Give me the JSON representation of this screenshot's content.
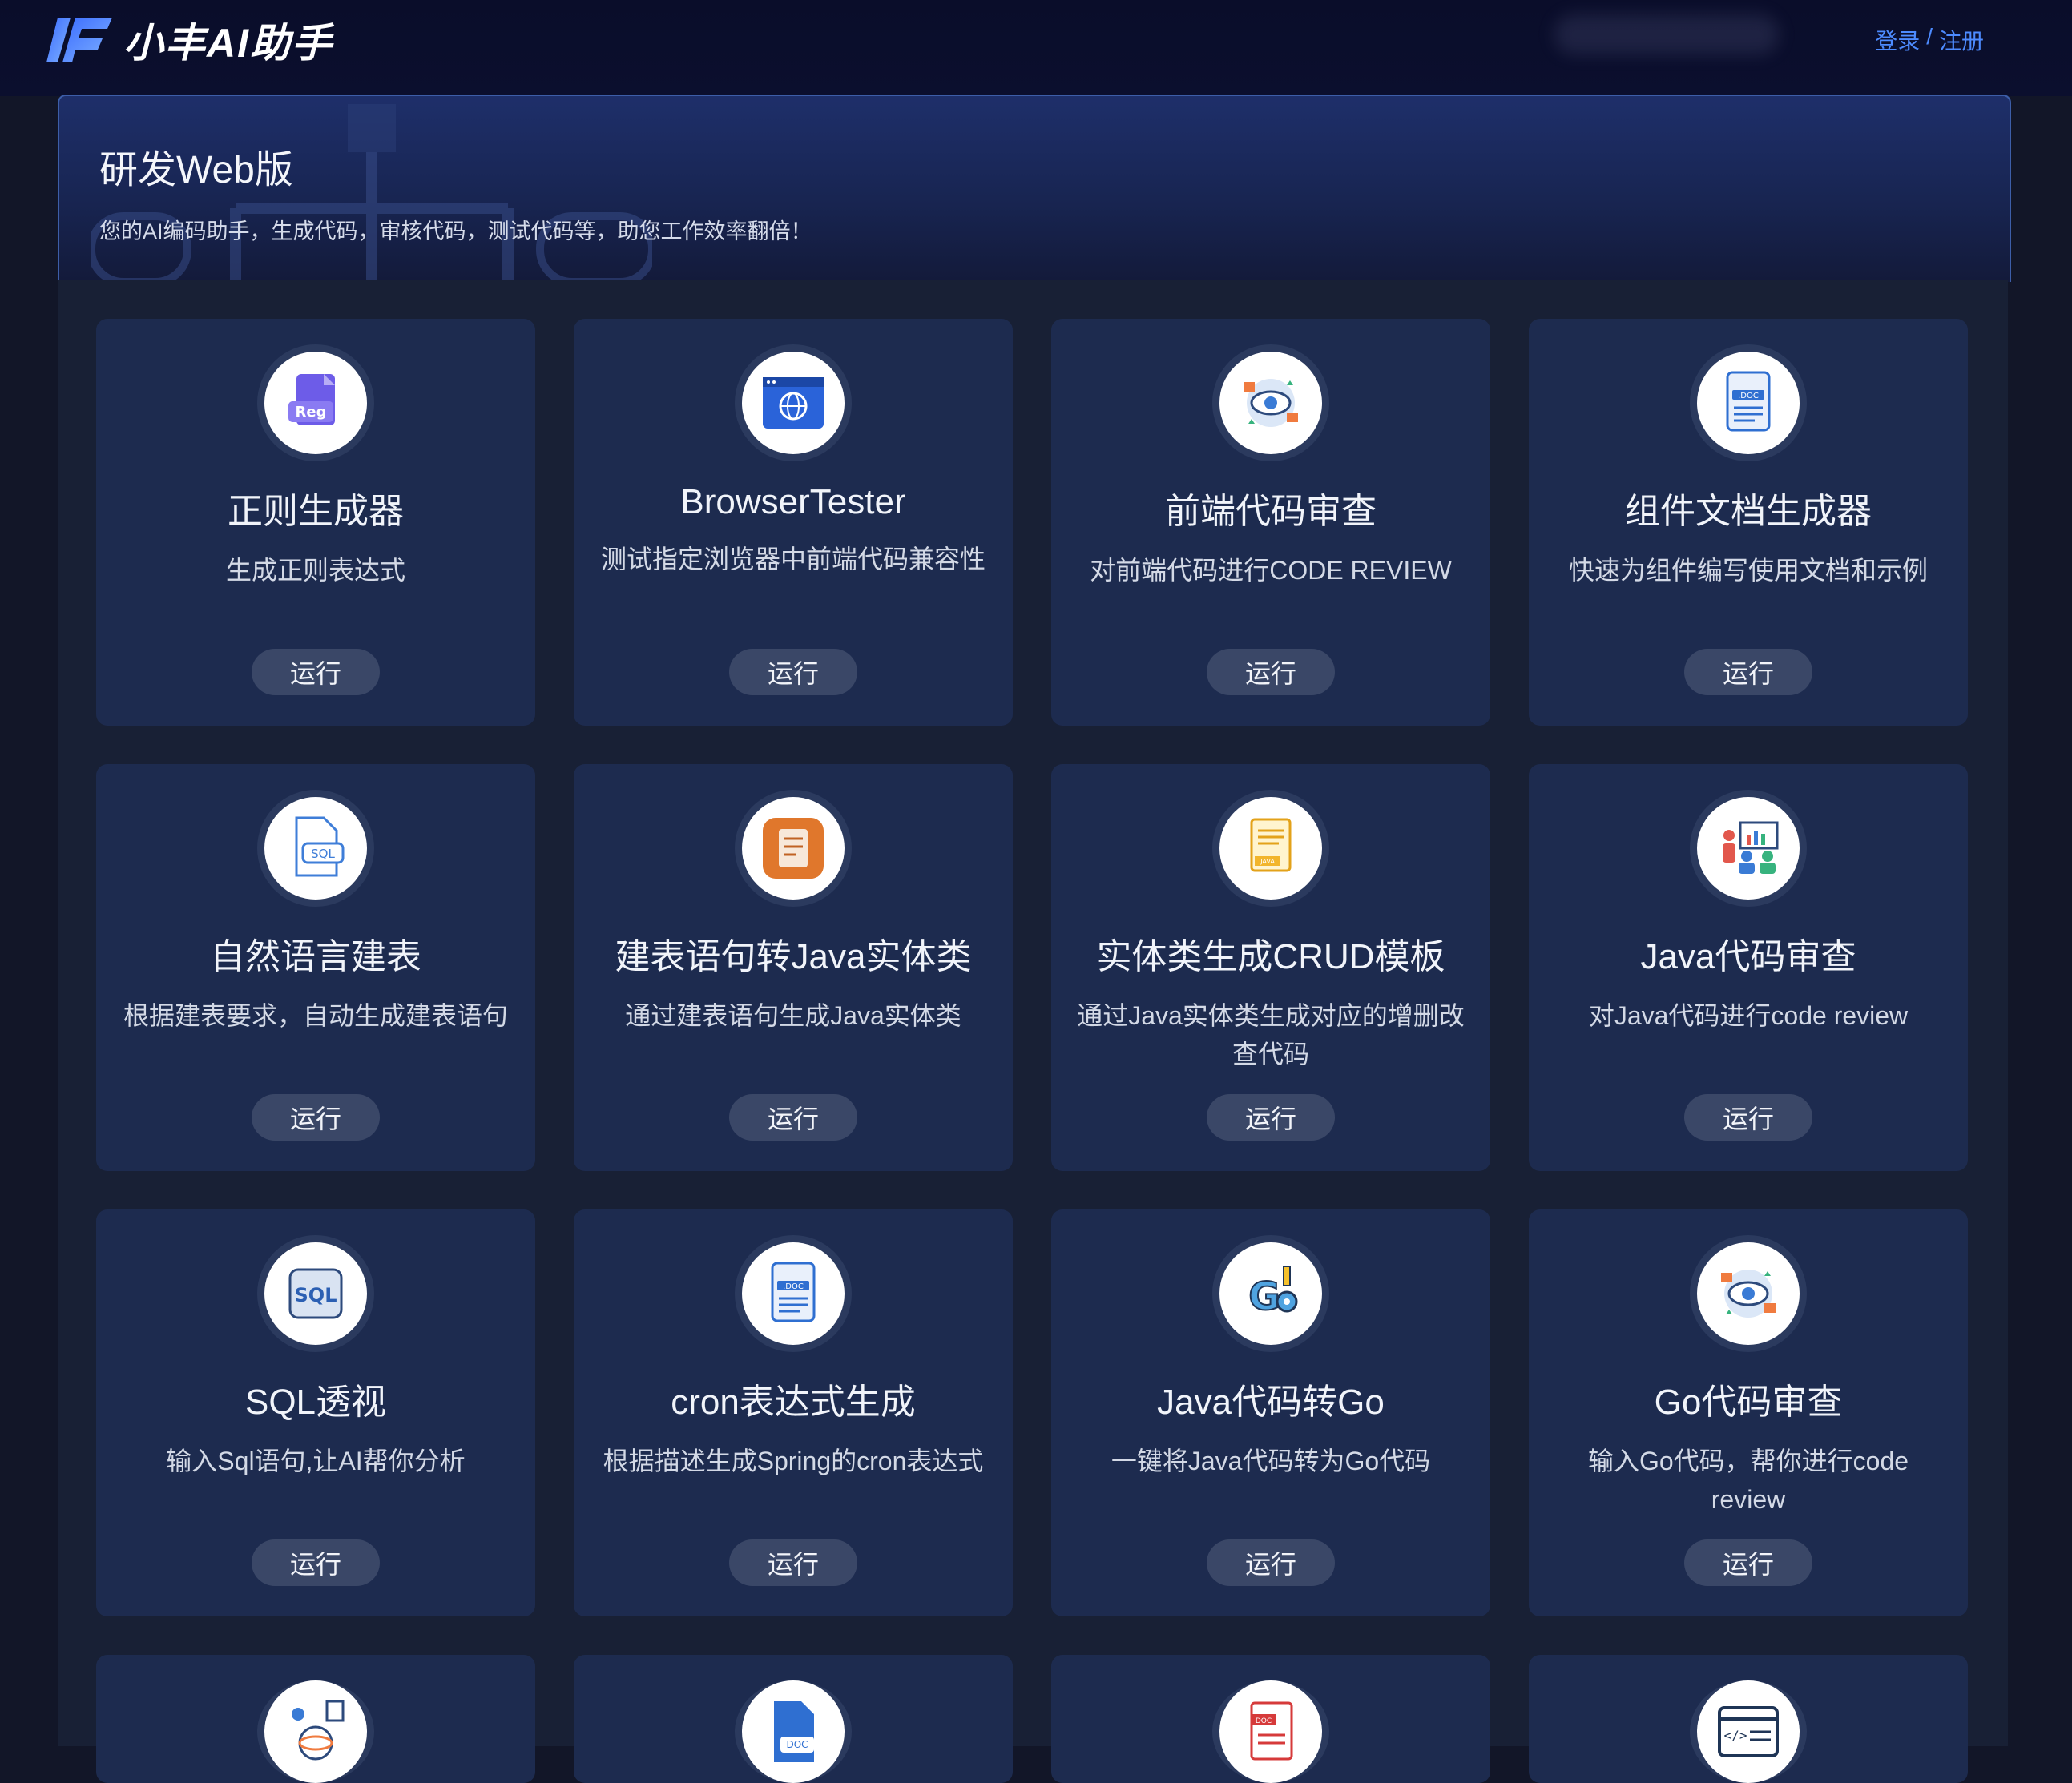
{
  "app": {
    "logo_text": "小丰AI助手",
    "auth_login": "登录",
    "auth_sep": "/",
    "auth_register": "注册"
  },
  "hero": {
    "title": "研发Web版",
    "subtitle": "您的AI编码助手，生成代码，审核代码，测试代码等，助您工作效率翻倍！"
  },
  "run_label": "运行",
  "cards": [
    {
      "title": "正则生成器",
      "desc": "生成正则表达式",
      "icon": "regex-doc-icon"
    },
    {
      "title": "BrowserTester",
      "desc": "测试指定浏览器中前端代码兼容性",
      "icon": "browser-globe-icon"
    },
    {
      "title": "前端代码审查",
      "desc": "对前端代码进行CODE REVIEW",
      "icon": "eye-review-icon"
    },
    {
      "title": "组件文档生成器",
      "desc": "快速为组件编写使用文档和示例",
      "icon": "doc-file-icon"
    },
    {
      "title": "自然语言建表",
      "desc": "根据建表要求，自动生成建表语句",
      "icon": "sql-file-icon"
    },
    {
      "title": "建表语句转Java实体类",
      "desc": "通过建表语句生成Java实体类",
      "icon": "orange-note-icon"
    },
    {
      "title": "实体类生成CRUD模板",
      "desc": "通过Java实体类生成对应的增删改查代码",
      "icon": "java-doc-icon"
    },
    {
      "title": "Java代码审查",
      "desc": "对Java代码进行code review",
      "icon": "team-review-icon"
    },
    {
      "title": "SQL透视",
      "desc": "输入Sql语句,让AI帮你分析",
      "icon": "sql-badge-icon"
    },
    {
      "title": "cron表达式生成",
      "desc": "根据描述生成Spring的cron表达式",
      "icon": "doc-file-icon"
    },
    {
      "title": "Java代码转Go",
      "desc": "一键将Java代码转为Go代码",
      "icon": "go-icon"
    },
    {
      "title": "Go代码审查",
      "desc": "输入Go代码，帮你进行code review",
      "icon": "eye-review-icon"
    },
    {
      "title": "",
      "desc": "",
      "icon": "atom-review-icon"
    },
    {
      "title": "",
      "desc": "",
      "icon": "blue-doc-icon"
    },
    {
      "title": "",
      "desc": "",
      "icon": "red-doc-icon"
    },
    {
      "title": "",
      "desc": "",
      "icon": "code-window-icon"
    }
  ]
}
